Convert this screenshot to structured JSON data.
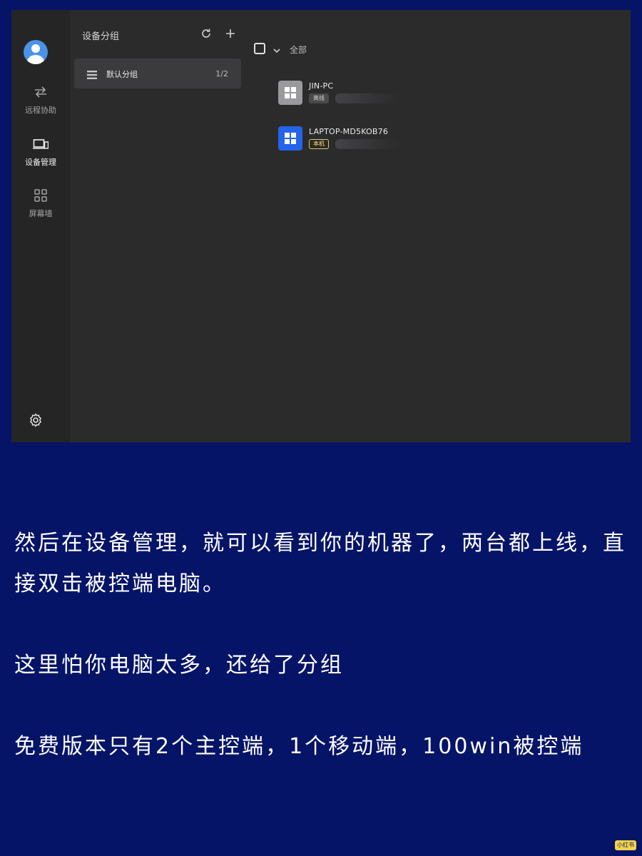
{
  "sidebar": {
    "items": [
      {
        "label": "远程协助",
        "icon": "swap-arrows-icon"
      },
      {
        "label": "设备管理",
        "icon": "devices-icon"
      },
      {
        "label": "屏幕墙",
        "icon": "grid-icon"
      }
    ],
    "active_index": 1,
    "settings_icon": "gear-icon"
  },
  "groups": {
    "title": "设备分组",
    "items": [
      {
        "name": "默认分组",
        "count": "1/2"
      }
    ]
  },
  "main": {
    "filter_label": "全部",
    "devices": [
      {
        "name": "JIN-PC",
        "badge": "离线",
        "os_color": "#9a9a9c"
      },
      {
        "name": "LAPTOP-MD5KOB76",
        "badge": "本机",
        "os_color": "#2563eb"
      }
    ]
  },
  "caption": {
    "paragraph1": "然后在设备管理，就可以看到你的机器了，两台都上线，直接双击被控端电脑。",
    "paragraph2": "这里怕你电脑太多，还给了分组",
    "paragraph3": "免费版本只有2个主控端，1个移动端，100win被控端"
  },
  "watermark": "小红书",
  "colors": {
    "page_background": "#061467",
    "window_background": "#2b2b2c",
    "accent_blue": "#2563eb",
    "local_badge_border": "#d8c678"
  }
}
